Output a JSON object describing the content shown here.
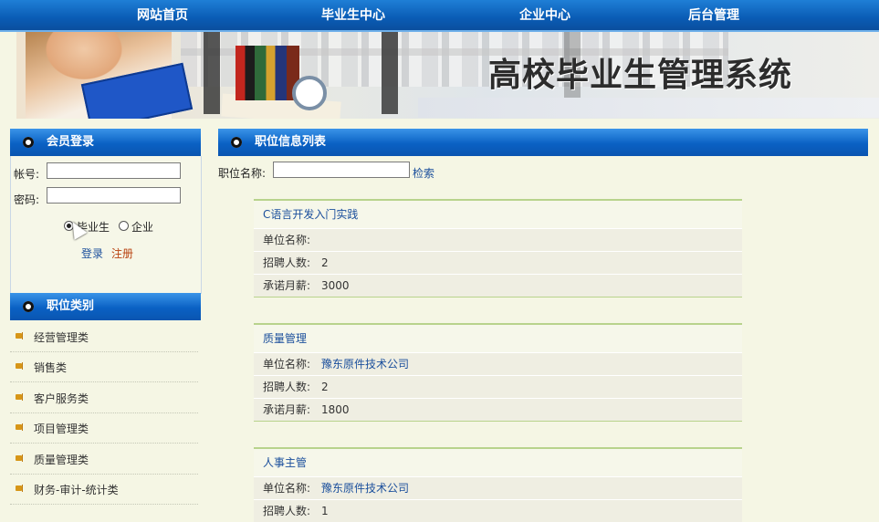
{
  "nav": {
    "items": [
      "网站首页",
      "毕业生中心",
      "企业中心",
      "后台管理"
    ]
  },
  "banner": {
    "title": "高校毕业生管理系统"
  },
  "login": {
    "header": "会员登录",
    "account_label": "帐号:",
    "password_label": "密码:",
    "account_value": "",
    "password_value": "",
    "role_options": [
      "毕业生",
      "企业"
    ],
    "role_selected": "毕业生",
    "login_label": "登录",
    "register_label": "注册"
  },
  "categories": {
    "header": "职位类别",
    "items": [
      "经营管理类",
      "销售类",
      "客户服务类",
      "项目管理类",
      "质量管理类",
      "财务-审计-统计类"
    ]
  },
  "jobs": {
    "header": "职位信息列表",
    "search_label": "职位名称:",
    "search_value": "",
    "search_button": "检索",
    "field_company": "单位名称:",
    "field_count": "招聘人数:",
    "field_salary": "承诺月薪:",
    "list": [
      {
        "title": "C语言开发入门实践",
        "company": "",
        "count": "2",
        "salary": "3000"
      },
      {
        "title": "质量管理",
        "company": "豫东原件技术公司",
        "count": "2",
        "salary": "1800"
      },
      {
        "title": "人事主管",
        "company": "豫东原件技术公司",
        "count": "1",
        "salary": ""
      }
    ]
  },
  "colors": {
    "nav_blue": "#0a5cb5",
    "accent_green": "#b8d38c",
    "page_bg": "#f5f6e4"
  }
}
